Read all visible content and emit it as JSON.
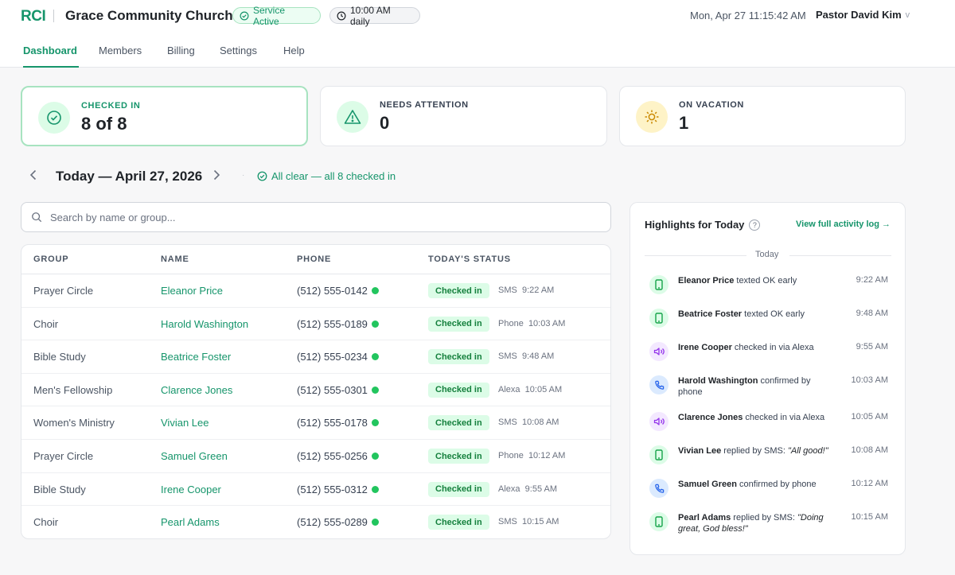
{
  "header": {
    "brand": "RCI",
    "org_name": "Grace Community Church",
    "service_status": "Service Active",
    "schedule": "10:00 AM daily",
    "datetime": "Mon, Apr 27 11:15:42 AM",
    "user": "Pastor David Kim",
    "user_chevron": "v"
  },
  "nav": {
    "tabs": [
      {
        "label": "Dashboard",
        "active": true
      },
      {
        "label": "Members",
        "active": false
      },
      {
        "label": "Billing",
        "active": false
      },
      {
        "label": "Settings",
        "active": false
      },
      {
        "label": "Help",
        "active": false
      }
    ]
  },
  "stats": {
    "checked_in": {
      "label": "CHECKED IN",
      "value": "8 of 8",
      "icon": "check-circle-icon"
    },
    "needs_attention": {
      "label": "NEEDS ATTENTION",
      "value": "0",
      "icon": "warning-triangle-icon"
    },
    "on_vacation": {
      "label": "ON VACATION",
      "value": "1",
      "icon": "sun-icon"
    }
  },
  "datebar": {
    "title": "Today — April 27, 2026",
    "status": "All clear — all 8 checked in",
    "separator": "·"
  },
  "search": {
    "placeholder": "Search by name or group...",
    "value": ""
  },
  "table": {
    "headers": [
      "GROUP",
      "NAME",
      "PHONE",
      "TODAY'S STATUS"
    ],
    "rows": [
      {
        "group": "Prayer Circle",
        "name": "Eleanor Price",
        "phone": "(512) 555-0142",
        "status": "Checked in",
        "via": "SMS",
        "time": "9:22 AM"
      },
      {
        "group": "Choir",
        "name": "Harold Washington",
        "phone": "(512) 555-0189",
        "status": "Checked in",
        "via": "Phone",
        "time": "10:03 AM"
      },
      {
        "group": "Bible Study",
        "name": "Beatrice Foster",
        "phone": "(512) 555-0234",
        "status": "Checked in",
        "via": "SMS",
        "time": "9:48 AM"
      },
      {
        "group": "Men's Fellowship",
        "name": "Clarence Jones",
        "phone": "(512) 555-0301",
        "status": "Checked in",
        "via": "Alexa",
        "time": "10:05 AM"
      },
      {
        "group": "Women's Ministry",
        "name": "Vivian Lee",
        "phone": "(512) 555-0178",
        "status": "Checked in",
        "via": "SMS",
        "time": "10:08 AM"
      },
      {
        "group": "Prayer Circle",
        "name": "Samuel Green",
        "phone": "(512) 555-0256",
        "status": "Checked in",
        "via": "Phone",
        "time": "10:12 AM"
      },
      {
        "group": "Bible Study",
        "name": "Irene Cooper",
        "phone": "(512) 555-0312",
        "status": "Checked in",
        "via": "Alexa",
        "time": "9:55 AM"
      },
      {
        "group": "Choir",
        "name": "Pearl Adams",
        "phone": "(512) 555-0289",
        "status": "Checked in",
        "via": "SMS",
        "time": "10:15 AM"
      }
    ]
  },
  "highlights": {
    "title": "Highlights for Today",
    "help": "?",
    "link": "View full activity log →",
    "day_label": "Today",
    "events": [
      {
        "type": "sms",
        "icon": "smartphone-icon",
        "name": "Eleanor Price",
        "text": " texted OK early",
        "quote": "",
        "time": "9:22 AM"
      },
      {
        "type": "sms",
        "icon": "smartphone-icon",
        "name": "Beatrice Foster",
        "text": " texted OK early",
        "quote": "",
        "time": "9:48 AM"
      },
      {
        "type": "alexa",
        "icon": "speaker-icon",
        "name": "Irene Cooper",
        "text": " checked in via Alexa",
        "quote": "",
        "time": "9:55 AM"
      },
      {
        "type": "phone",
        "icon": "phone-icon",
        "name": "Harold Washington",
        "text": " confirmed by phone",
        "quote": "",
        "time": "10:03 AM"
      },
      {
        "type": "alexa",
        "icon": "speaker-icon",
        "name": "Clarence Jones",
        "text": " checked in via Alexa",
        "quote": "",
        "time": "10:05 AM"
      },
      {
        "type": "sms",
        "icon": "smartphone-icon",
        "name": "Vivian Lee",
        "text": " replied by SMS: ",
        "quote": "\"All good!\"",
        "time": "10:08 AM"
      },
      {
        "type": "phone",
        "icon": "phone-icon",
        "name": "Samuel Green",
        "text": " confirmed by phone",
        "quote": "",
        "time": "10:12 AM"
      },
      {
        "type": "sms",
        "icon": "smartphone-icon",
        "name": "Pearl Adams",
        "text": " replied by SMS: ",
        "quote": "\"Doing great, God bless!\"",
        "time": "10:15 AM"
      }
    ]
  },
  "colors": {
    "brand": "#16956b",
    "success_bg": "#dcfce7",
    "status_dot": "#22c55e",
    "vacation_icon": "#ca8a04"
  }
}
